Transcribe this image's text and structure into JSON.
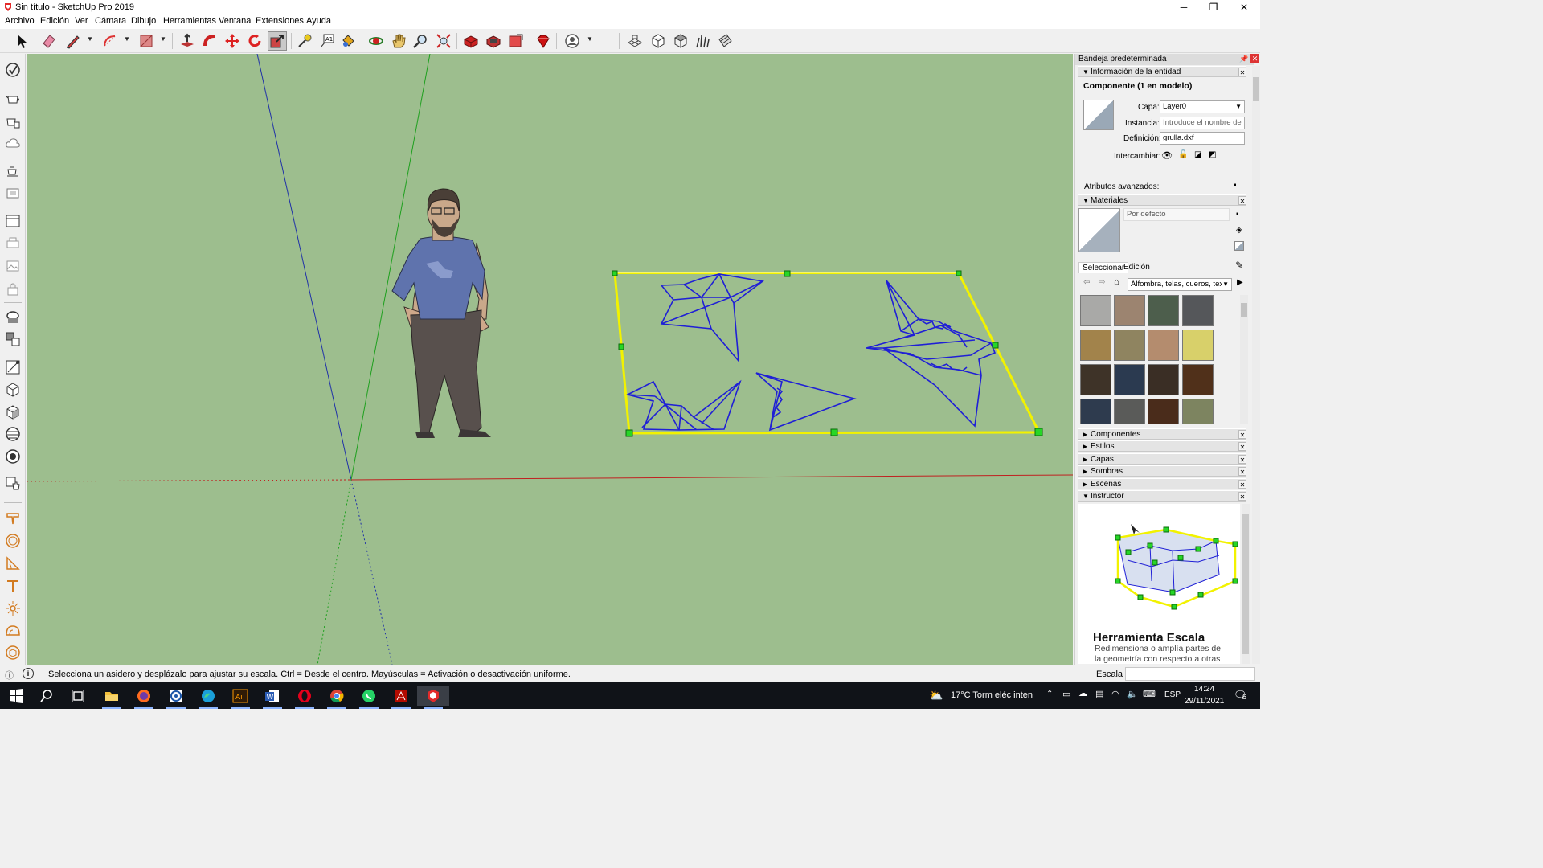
{
  "window": {
    "title": "Sin título - SketchUp Pro 2019",
    "minimize": "─",
    "maximize": "❐",
    "close": "✕"
  },
  "menu": [
    "Archivo",
    "Edición",
    "Ver",
    "Cámara",
    "Dibujo",
    "Herramientas",
    "Ventana",
    "Extensiones",
    "Ayuda"
  ],
  "toolbar": {
    "active_tool": "scale-tool",
    "tools": [
      "select",
      "eraser",
      "line",
      "arc",
      "rectangle",
      "push-pull",
      "follow-me",
      "move",
      "rotate",
      "scale",
      "tape-measure",
      "text",
      "paint-bucket",
      "orbit",
      "pan",
      "zoom",
      "zoom-extents",
      "3d-warehouse",
      "extension-warehouse",
      "layout",
      "ruby",
      "account",
      "sandbox-from-contours",
      "iso",
      "top",
      "front",
      "sections"
    ]
  },
  "status": {
    "message": "Selecciona un asidero y desplázalo para ajustar su escala. Ctrl = Desde el centro. Mayúsculas = Activación o desactivación uniforme.",
    "measurement_label": "Escala",
    "measurement_value": ""
  },
  "tray": {
    "title": "Bandeja predeterminada",
    "entity_info": {
      "header": "Información de la entidad",
      "entity_type": "Componente (1 en modelo)",
      "layer_label": "Capa:",
      "layer_value": "Layer0",
      "instance_label": "Instancia:",
      "instance_placeholder": "Introduce el nombre de la",
      "definition_label": "Definición:",
      "definition_value": "grulla.dxf",
      "toggle_label": "Intercambiar:",
      "advanced_label": "Atributos avanzados:"
    },
    "materials": {
      "header": "Materiales",
      "current_name": "Por defecto",
      "tab_select": "Seleccionar",
      "tab_edit": "Edición",
      "library": "Alfombra, telas, cueros, tex",
      "swatch_colors": [
        "#a9a9a7",
        "#9c8470",
        "#4d5e4c",
        "#55575a",
        "#a2834b",
        "#8f8460",
        "#b48c6e",
        "#d8d06a",
        "#3e3328",
        "#2b3a50",
        "#3a2e25",
        "#50301a",
        "#2e3b4e",
        "#5a5b59",
        "#4a2c1b",
        "#7d8460"
      ]
    },
    "collapsed_panels": [
      "Componentes",
      "Estilos",
      "Capas",
      "Sombras",
      "Escenas"
    ],
    "instructor": {
      "header": "Instructor",
      "tool_title": "Herramienta Escala",
      "description_line1": "Redimensiona o amplía partes de",
      "description_line2": "la geometría con respecto a otras"
    }
  },
  "taskbar": {
    "weather": "17°C  Torm eléc inten",
    "language": "ESP",
    "time": "14:24",
    "date": "29/11/2021",
    "notifications": "6"
  },
  "colors": {
    "viewport_bg": "#9dbe8e",
    "selection": "#f2f200",
    "geometry": "#1f1fd6",
    "grip": "#27d627"
  }
}
